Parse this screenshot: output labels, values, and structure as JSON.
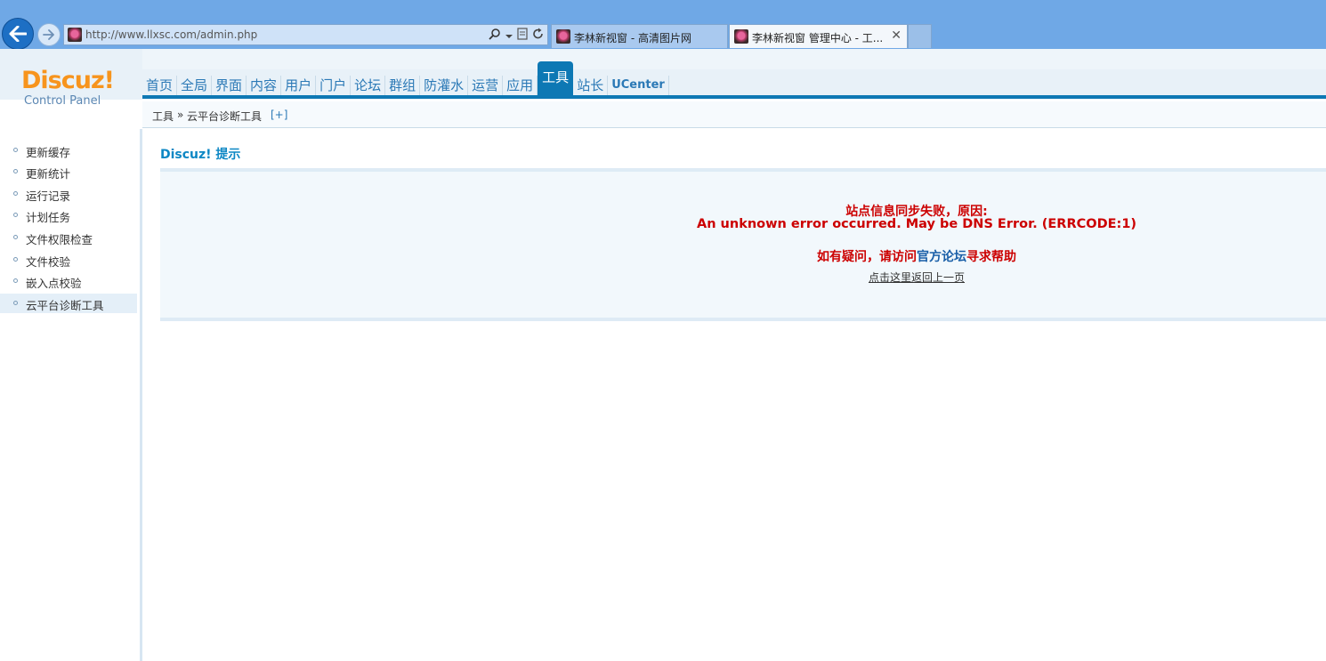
{
  "browser": {
    "address": "http://www.llxsc.com/admin.php",
    "tabs": [
      {
        "label": "李林新视窗 - 高清图片网",
        "active": false
      },
      {
        "label": "李林新视窗 管理中心 - 工...",
        "active": true,
        "close": "✕"
      }
    ]
  },
  "logo": {
    "brand": "Discuz!",
    "sub": "Control Panel"
  },
  "nav": {
    "items": [
      "首页",
      "全局",
      "界面",
      "内容",
      "用户",
      "门户",
      "论坛",
      "群组",
      "防灌水",
      "运营",
      "应用",
      "工具",
      "站长",
      "UCenter"
    ],
    "active": "工具"
  },
  "breadcrumb": {
    "section": "工具",
    "sep": "»",
    "page": "云平台诊断工具",
    "toggle": "[+]"
  },
  "sidebar": {
    "items": [
      "更新缓存",
      "更新统计",
      "运行记录",
      "计划任务",
      "文件权限检查",
      "文件校验",
      "嵌入点校验",
      "云平台诊断工具"
    ],
    "active": "云平台诊断工具"
  },
  "main": {
    "title": "Discuz! 提示",
    "message_line1": "站点信息同步失败，原因:",
    "message_line2": "An unknown error occurred. May be DNS Error. (ERRCODE:1)",
    "help_prefix": "如有疑问，请访问",
    "help_link": "官方论坛",
    "help_suffix": "寻求帮助",
    "back_link": "点击这里返回上一页"
  },
  "colors": {
    "accent": "#0d78b4",
    "error": "#cc0000",
    "logo": "#f7941d",
    "link": "#2b79b6"
  }
}
